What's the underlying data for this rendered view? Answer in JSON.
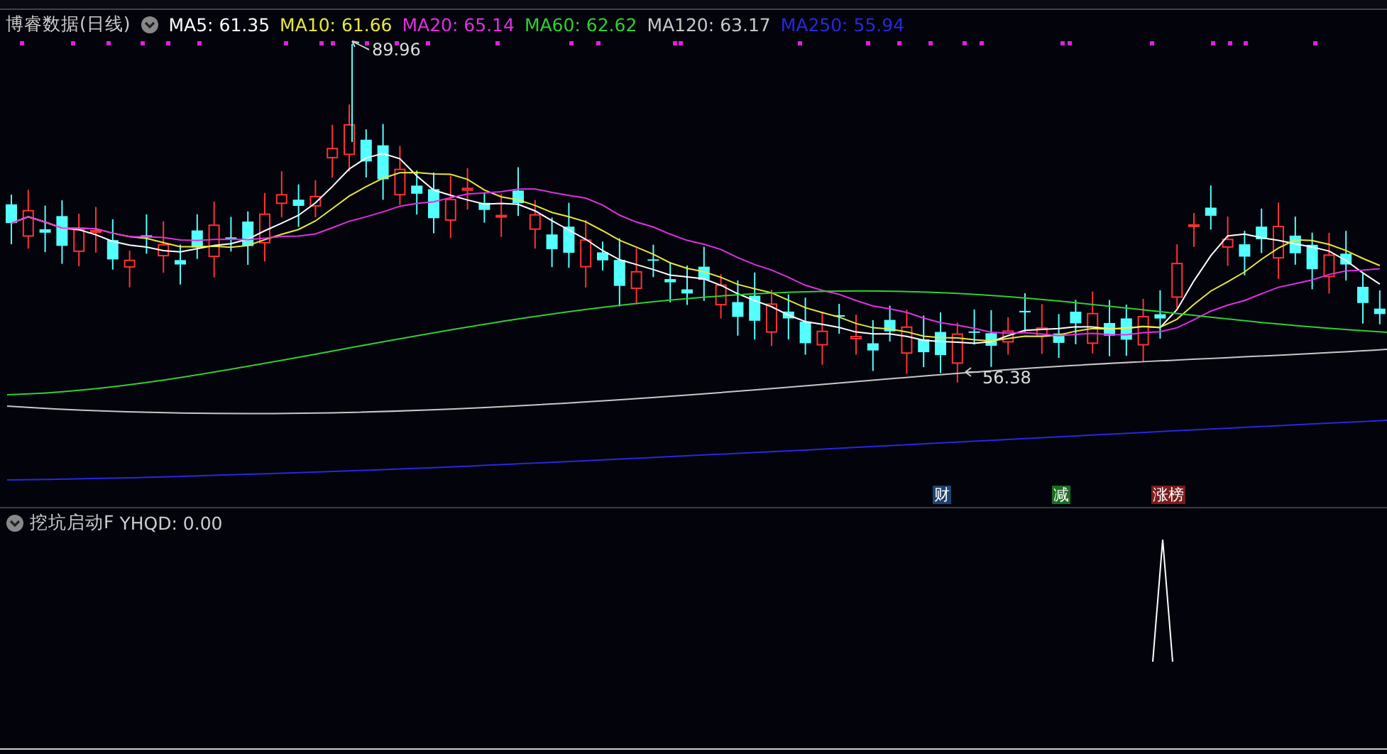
{
  "main_panel": {
    "title": "博睿数据(日线)",
    "ma_values": [
      {
        "label": "MA5: 61.35",
        "color": "#ffffff"
      },
      {
        "label": "MA10: 61.66",
        "color": "#e8e83a"
      },
      {
        "label": "MA20: 65.14",
        "color": "#e030e0"
      },
      {
        "label": "MA60: 62.62",
        "color": "#30d030"
      },
      {
        "label": "MA120: 63.17",
        "color": "#c8c8c8"
      },
      {
        "label": "MA250: 55.94",
        "color": "#2828e0"
      }
    ],
    "price_labels": [
      {
        "text": "89.96",
        "kind": "high"
      },
      {
        "text": "56.38",
        "kind": "low"
      }
    ],
    "event_badges": [
      {
        "text": "财",
        "color": "#1d4470"
      },
      {
        "text": "减",
        "color": "#1b6e22"
      },
      {
        "text": "涨榜",
        "color": "#7a1c1c"
      }
    ]
  },
  "indicator_panel": {
    "title": "挖坑启动F",
    "reading": "YHQD: 0.00"
  }
}
